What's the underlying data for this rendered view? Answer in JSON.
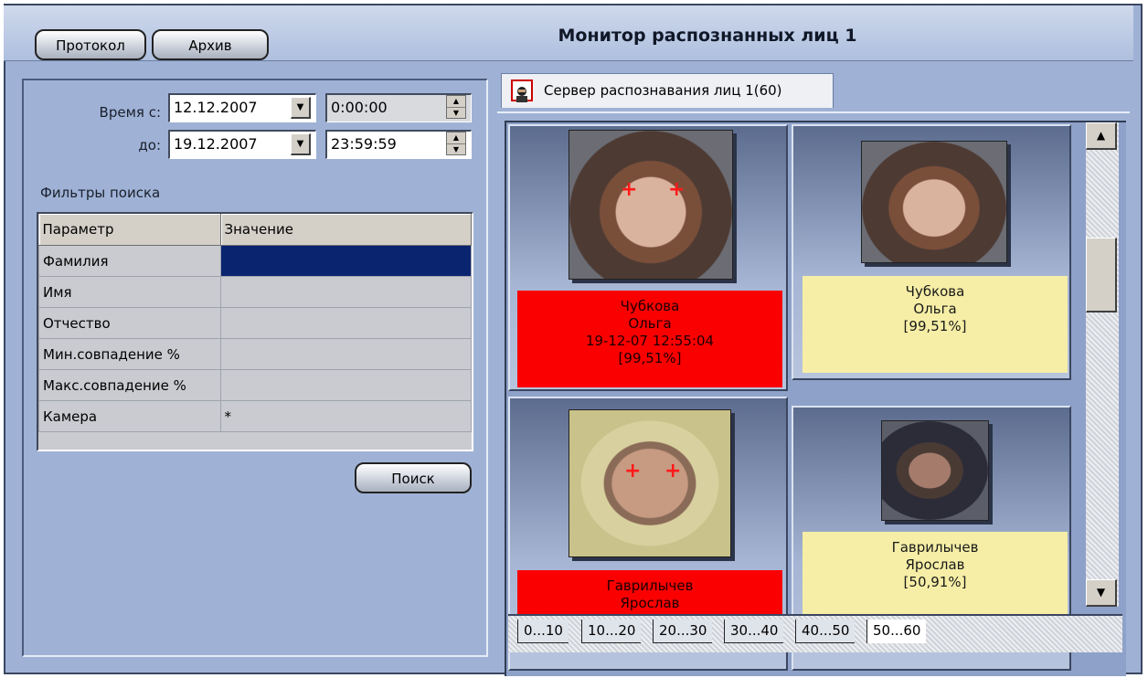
{
  "window": {
    "title": "Монитор распознанных лиц 1"
  },
  "toolbar": {
    "protocol_label": "Протокол",
    "archive_label": "Архив"
  },
  "filter": {
    "time_from_label": "Время с:",
    "time_to_label": "до:",
    "date_from": "12.12.2007",
    "time_from": "0:00:00",
    "date_to": "19.12.2007",
    "time_to": "23:59:59",
    "section_title": "Фильтры поиска",
    "grid_headers": [
      "Параметр",
      "Значение"
    ],
    "grid_rows": [
      {
        "param": "Фамилия",
        "value": ""
      },
      {
        "param": "Имя",
        "value": ""
      },
      {
        "param": "Отчество",
        "value": ""
      },
      {
        "param": "Мин.совпадение %",
        "value": ""
      },
      {
        "param": "Макс.совпадение %",
        "value": ""
      },
      {
        "param": "Камера",
        "value": "*"
      }
    ],
    "search_label": "Поиск"
  },
  "server_tab": {
    "label": "Сервер распознавания лиц 1(60)"
  },
  "cards": [
    {
      "last_name": "Чубкова",
      "first_name": "Ольга",
      "timestamp": "19-12-07 12:55:04",
      "score": "[99,51%]"
    },
    {
      "last_name": "Чубкова",
      "first_name": "Ольга",
      "score": "[99,51%]"
    },
    {
      "last_name": "Гаврилычев",
      "first_name": "Ярослав"
    },
    {
      "last_name": "Гаврилычев",
      "first_name": "Ярослав",
      "score": "[50,91%]"
    }
  ],
  "page_tabs": [
    "0...10",
    "10...20",
    "20...30",
    "30...40",
    "40...50",
    "50...60"
  ],
  "colors": {
    "match_red": "#fb0000",
    "info_yellow": "#f6eea6",
    "selection_navy": "#0a2470"
  }
}
